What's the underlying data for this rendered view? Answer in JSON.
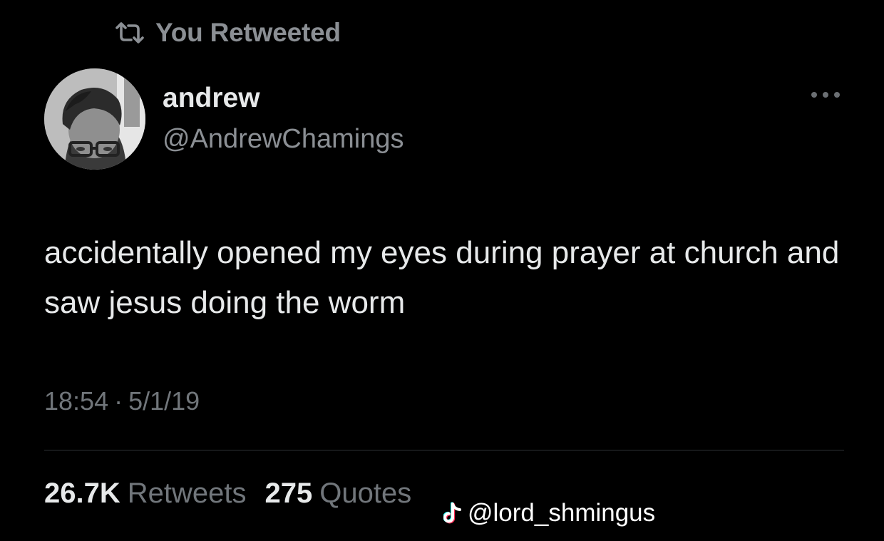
{
  "retweet": {
    "label": "You Retweeted",
    "icon": "retweet-icon"
  },
  "author": {
    "display_name": "andrew",
    "handle": "@AndrewChamings",
    "avatar": "avatar-photo"
  },
  "menu": {
    "icon": "more-horizontal-icon"
  },
  "tweet": {
    "text": "accidentally opened my eyes during prayer at church and saw jesus doing the worm",
    "time": "18:54",
    "separator": "·",
    "date": "5/1/19"
  },
  "stats": {
    "retweets_value": "26.7K",
    "retweets_label": "Retweets",
    "quotes_value": "275",
    "quotes_label": "Quotes"
  },
  "watermark": {
    "icon": "tiktok-icon",
    "text": "@lord_shmingus"
  },
  "colors": {
    "background": "#000000",
    "primary_text": "#e7e9ea",
    "secondary_text": "#71767b",
    "divider": "#2f3336"
  }
}
